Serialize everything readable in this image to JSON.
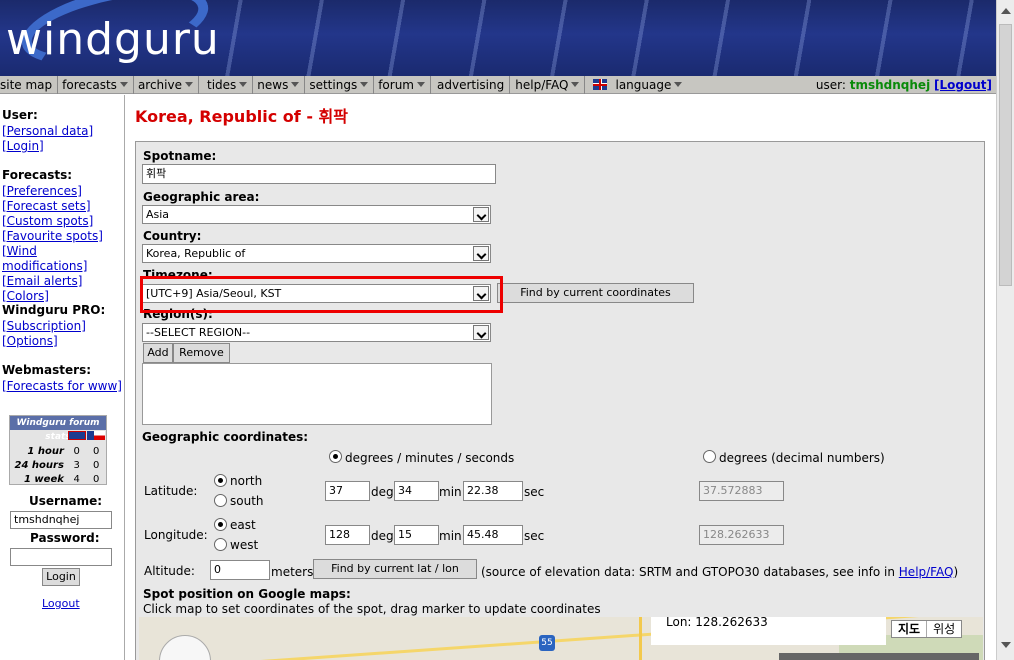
{
  "header": {
    "logo": "windguru"
  },
  "menu": [
    {
      "label": "site map",
      "caret": false
    },
    {
      "label": "forecasts",
      "caret": true
    },
    {
      "label": "archive",
      "caret": true
    },
    {
      "label": "tides",
      "caret": true
    },
    {
      "label": "news",
      "caret": true
    },
    {
      "label": "settings",
      "caret": true
    },
    {
      "label": "forum",
      "caret": true
    },
    {
      "label": "advertising",
      "caret": false
    },
    {
      "label": "help/FAQ",
      "caret": true
    },
    {
      "label": "language",
      "caret": true
    }
  ],
  "user": {
    "prefix": "user:",
    "name": "tmshdnqhej",
    "logout": "[Logout]"
  },
  "sidebar": {
    "user_head": "User:",
    "user_links": [
      "[Personal data]",
      "[Login]"
    ],
    "forecasts_head": "Forecasts:",
    "forecast_links": [
      "[Preferences]",
      "[Forecast sets]",
      "[Custom spots]",
      "[Favourite spots]",
      "[Wind modifications]",
      "[Email alerts]",
      "[Colors]"
    ],
    "pro_head": "Windguru PRO:",
    "pro_links": [
      "[Subscription]",
      "[Options]"
    ],
    "web_head": "Webmasters:",
    "web_links": [
      "[Forecasts for www]"
    ],
    "stats": {
      "title": "Windguru forum stats",
      "rows": [
        {
          "label": "1 hour",
          "uk": "0",
          "cz": "0"
        },
        {
          "label": "24 hours",
          "uk": "3",
          "cz": "0"
        },
        {
          "label": "1 week",
          "uk": "4",
          "cz": "0"
        }
      ]
    },
    "username_label": "Username:",
    "username_value": "tmshdnqhej",
    "password_label": "Password:",
    "login_button": "Login",
    "logout_link": "Logout"
  },
  "page": {
    "title_country": "Korea, Republic of",
    "title_spot": " - 휘팍"
  },
  "form": {
    "spotname_label": "Spotname:",
    "spotname_value": "휘팍",
    "geo_label": "Geographic area:",
    "geo_value": "Asia",
    "country_label": "Country:",
    "country_value": "Korea, Republic of",
    "timezone_label": "Timezone:",
    "timezone_value": "[UTC+9] Asia/Seoul, KST",
    "find_coords_button": "Find by current coordinates",
    "region_label": "Region(s):",
    "region_value": "--SELECT REGION--",
    "add_button": "Add",
    "remove_button": "Remove",
    "coords_label": "Geographic coordinates:",
    "dms_option": "degrees / minutes / seconds",
    "decimal_option": "degrees (decimal numbers)",
    "latitude_label": "Latitude:",
    "north": "north",
    "south": "south",
    "lat_deg": "37",
    "lat_min": "34",
    "lat_sec": "22.38",
    "lat_decimal": "37.572883",
    "longitude_label": "Longitude:",
    "east": "east",
    "west": "west",
    "lon_deg": "128",
    "lon_min": "15",
    "lon_sec": "45.48",
    "lon_decimal": "128.262633",
    "deg_unit": "deg",
    "min_unit": "min",
    "sec_unit": "sec",
    "altitude_label": "Altitude:",
    "altitude_value": "0",
    "meters_unit": "meters",
    "find_latlon_button": "Find by current lat / lon",
    "elevation_note": "(source of elevation data: SRTM and GTOPO30 databases, see info in ",
    "help_link": "Help/FAQ",
    "close_paren": ")",
    "spot_pos_label": "Spot position on Google maps:",
    "spot_pos_hint": "Click map to set coordinates of the spot, drag marker to update coordinates"
  },
  "map": {
    "popup": "Lon: 128.262633",
    "shield": "55",
    "map_button": "지도",
    "sat_button": "위성"
  }
}
